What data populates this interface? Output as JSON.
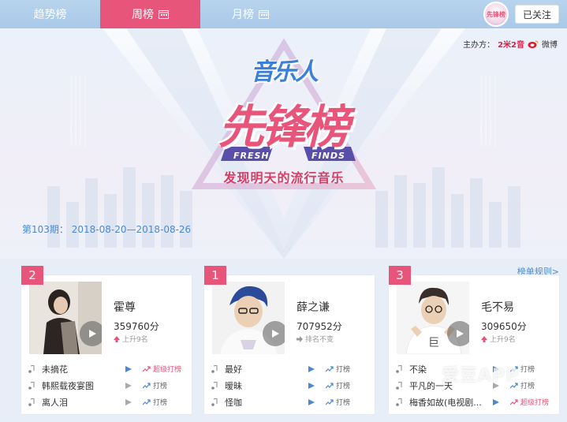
{
  "nav": {
    "tabs": [
      {
        "label": "趋势榜",
        "active": false,
        "icon": null
      },
      {
        "label": "周榜",
        "active": true,
        "icon": "calendar-icon"
      },
      {
        "label": "月榜",
        "active": false,
        "icon": "calendar-icon"
      }
    ],
    "follow_label": "已关注",
    "logo_text": "先锋榜"
  },
  "banner": {
    "sponsor_label": "主办方：",
    "sponsor_1": "2米2音",
    "sponsor_2": "微博",
    "title_line1": "音乐人",
    "title_line2": "先锋榜",
    "fresh_word": "FRESH",
    "finds_word": "FINDS",
    "slogan": "发现明天的流行音乐"
  },
  "period_text": "第103期：  2018-08-20—2018-08-26",
  "rules_link": "榜单规则>",
  "colors": {
    "accent": "#e8557a",
    "link": "#4a8ad0",
    "nav_bg": "#aecbe9"
  },
  "cards": [
    {
      "rank": "2",
      "artist": "霍尊",
      "score": "359760分",
      "trend_text": "上升9名",
      "trend_icon": "arrow-up-icon",
      "songs": [
        {
          "title": "未摘花",
          "hit_label": "超级打榜",
          "hit_pink": true
        },
        {
          "title": "韩熙载夜宴图",
          "hit_label": "打榜",
          "hit_pink": false
        },
        {
          "title": "离人泪",
          "hit_label": "打榜",
          "hit_pink": false
        }
      ]
    },
    {
      "rank": "1",
      "artist": "薛之谦",
      "score": "707952分",
      "trend_text": "排名不变",
      "trend_icon": "arrow-right-icon",
      "songs": [
        {
          "title": "最好",
          "hit_label": "打榜",
          "hit_pink": false
        },
        {
          "title": "暧昧",
          "hit_label": "打榜",
          "hit_pink": false
        },
        {
          "title": "怪咖",
          "hit_label": "打榜",
          "hit_pink": false
        }
      ]
    },
    {
      "rank": "3",
      "artist": "毛不易",
      "score": "309650分",
      "trend_text": "上升9名",
      "trend_icon": "arrow-up-icon",
      "songs": [
        {
          "title": "不染",
          "hit_label": "打榜",
          "hit_pink": false
        },
        {
          "title": "平凡的一天",
          "hit_label": "打榜",
          "hit_pink": false
        },
        {
          "title": "梅香如故(电视剧...",
          "hit_label": "超级打榜",
          "hit_pink": true
        }
      ]
    }
  ],
  "watermark": "爱豆APP"
}
